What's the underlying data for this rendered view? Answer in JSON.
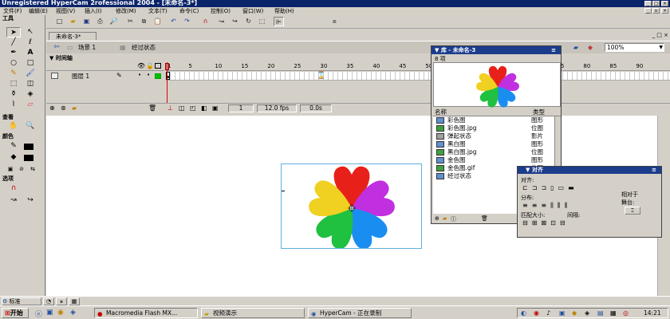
{
  "window": {
    "title": "Unregistered HyperCam 2rofessional 2004 - [未命名-3*]"
  },
  "menu": [
    "文件(F)",
    "编辑(E)",
    "视图(V)",
    "插入(I)",
    "修改(M)",
    "文本(T)",
    "命令(C)",
    "控制(O)",
    "窗口(W)",
    "帮助(H)"
  ],
  "tools_panel": {
    "title": "工具",
    "view_title": "查看",
    "color_title": "颜色",
    "options_title": "选项"
  },
  "document": {
    "tab_label": "未命名-3*",
    "scene_label": "场景 1",
    "symbol_label": "经过状态",
    "zoom": "100%"
  },
  "timeline": {
    "label": "时间轴",
    "layer_name": "图层 1",
    "ruler": [
      "1",
      "5",
      "10",
      "15",
      "20",
      "25",
      "30",
      "35",
      "40",
      "45",
      "50",
      "55",
      "60",
      "65",
      "70",
      "75",
      "80",
      "85",
      "90"
    ],
    "current_frame": "1",
    "fps": "12.0 fps",
    "elapsed": "0.0s"
  },
  "library": {
    "title": "库 - 未命名-3",
    "count": "8 项",
    "col_name": "名称",
    "col_type": "类型",
    "items": [
      {
        "name": "彩色图",
        "type": "图形"
      },
      {
        "name": "彩色图.jpg",
        "type": "位图"
      },
      {
        "name": "弹起状态",
        "type": "影片"
      },
      {
        "name": "黑白图",
        "type": "图形"
      },
      {
        "name": "黑白图.jpg",
        "type": "位图"
      },
      {
        "name": "金色图",
        "type": "图形"
      },
      {
        "name": "金色图.gif",
        "type": "位图"
      },
      {
        "name": "经过状态",
        "type": ""
      }
    ]
  },
  "align": {
    "title": "对齐",
    "align_label": "对齐:",
    "distribute_label": "分布:",
    "match_size_label": "匹配大小:",
    "spacing_label": "间隔:",
    "to_stage_label": "相对于\n舞台:"
  },
  "props_bar": {
    "label": "标准"
  },
  "taskbar": {
    "start": "开始",
    "tasks": [
      "Macromedia Flash MX...",
      "视频演示",
      "HyperCam - 正在录制"
    ],
    "clock": "14:21"
  }
}
